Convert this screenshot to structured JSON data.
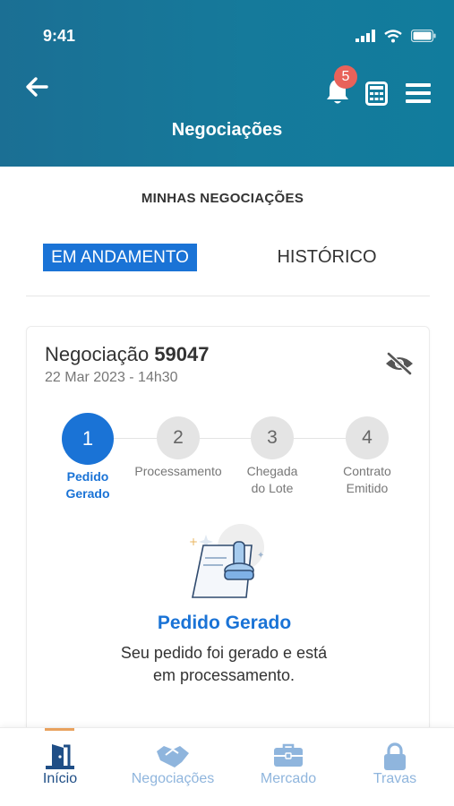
{
  "status_bar": {
    "time": "9:41"
  },
  "header": {
    "title": "Negociações",
    "notification_count": "5",
    "icons": [
      "back-arrow-icon",
      "bell-icon",
      "calculator-icon",
      "menu-icon"
    ]
  },
  "section_title": "MINHAS NEGOCIAÇÕES",
  "tabs": {
    "active": "EM ANDAMENTO",
    "history": "HISTÓRICO"
  },
  "card": {
    "title_prefix": "Negociação",
    "number": "59047",
    "date": "22 Mar 2023 - 14h30",
    "hide_icon": "eye-off-icon",
    "steps": [
      {
        "number": "1",
        "label_line1": "Pedido",
        "label_line2": "Gerado",
        "active": true
      },
      {
        "number": "2",
        "label_line1": "Processamento",
        "label_line2": "",
        "active": false
      },
      {
        "number": "3",
        "label_line1": "Chegada",
        "label_line2": "do Lote",
        "active": false
      },
      {
        "number": "4",
        "label_line1": "Contrato",
        "label_line2": "Emitido",
        "active": false
      }
    ],
    "status_title": "Pedido Gerado",
    "status_desc_line1": "Seu pedido foi gerado e está",
    "status_desc_line2": "em processamento."
  },
  "bottom_nav": [
    {
      "label": "Início",
      "icon": "door-icon",
      "active": true
    },
    {
      "label": "Negociações",
      "icon": "handshake-icon",
      "active": false
    },
    {
      "label": "Mercado",
      "icon": "briefcase-icon",
      "active": false
    },
    {
      "label": "Travas",
      "icon": "lock-icon",
      "active": false
    }
  ],
  "colors": {
    "header": "#1b6f94",
    "primary": "#1a73d6",
    "badge": "#e8625a",
    "nav_inactive": "#8fb5dd",
    "nav_active": "#1f4e86",
    "nav_indicator": "#e9a25e"
  }
}
